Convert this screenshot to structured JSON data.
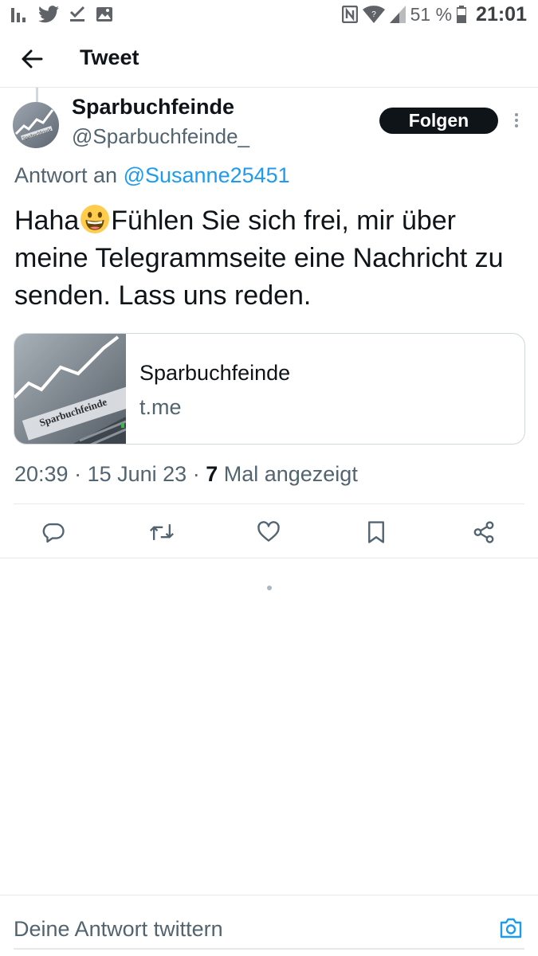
{
  "status_bar": {
    "battery_pct": "51 %",
    "time": "21:01",
    "left_icons": [
      "signal-bars-icon",
      "twitter-bird-icon",
      "download-check-icon",
      "image-icon"
    ],
    "right_icons": [
      "nfc-icon",
      "wifi-icon",
      "cell-signal-icon",
      "battery-icon"
    ]
  },
  "header": {
    "title": "Tweet",
    "back_icon": "arrow-left-icon"
  },
  "tweet": {
    "author_name": "Sparbuchfeinde",
    "author_handle": "@Sparbuchfeinde_",
    "follow_label": "Folgen",
    "reply_prefix": "Antwort an",
    "reply_mention": "@Susanne25451",
    "text_before_emoji": "Haha",
    "emoji": "grinning-face-emoji",
    "text_after_emoji": "Fühlen Sie sich frei, mir über meine Telegrammseite eine Nachricht zu senden. Lass uns reden.",
    "card": {
      "thumb_text": "Sparbuchfeinde",
      "title": "Sparbuchfeinde",
      "domain": "t.me"
    },
    "avatar_text": "Sparbuchfeinde",
    "meta_time": "20:39",
    "meta_sep1": " · ",
    "meta_date": "15 Juni 23",
    "meta_sep2": " · ",
    "meta_views_count": "7",
    "meta_views_label": " Mal angezeigt",
    "actions": [
      "reply-icon",
      "retweet-icon",
      "like-icon",
      "bookmark-icon",
      "share-icon"
    ]
  },
  "reply_bar": {
    "placeholder": "Deine Antwort twittern",
    "camera_icon": "camera-icon"
  },
  "colors": {
    "text": "#0f1419",
    "secondary": "#536471",
    "accent": "#1d9bf0",
    "divider": "#e6e9ec",
    "follow_bg": "#0f1419"
  }
}
